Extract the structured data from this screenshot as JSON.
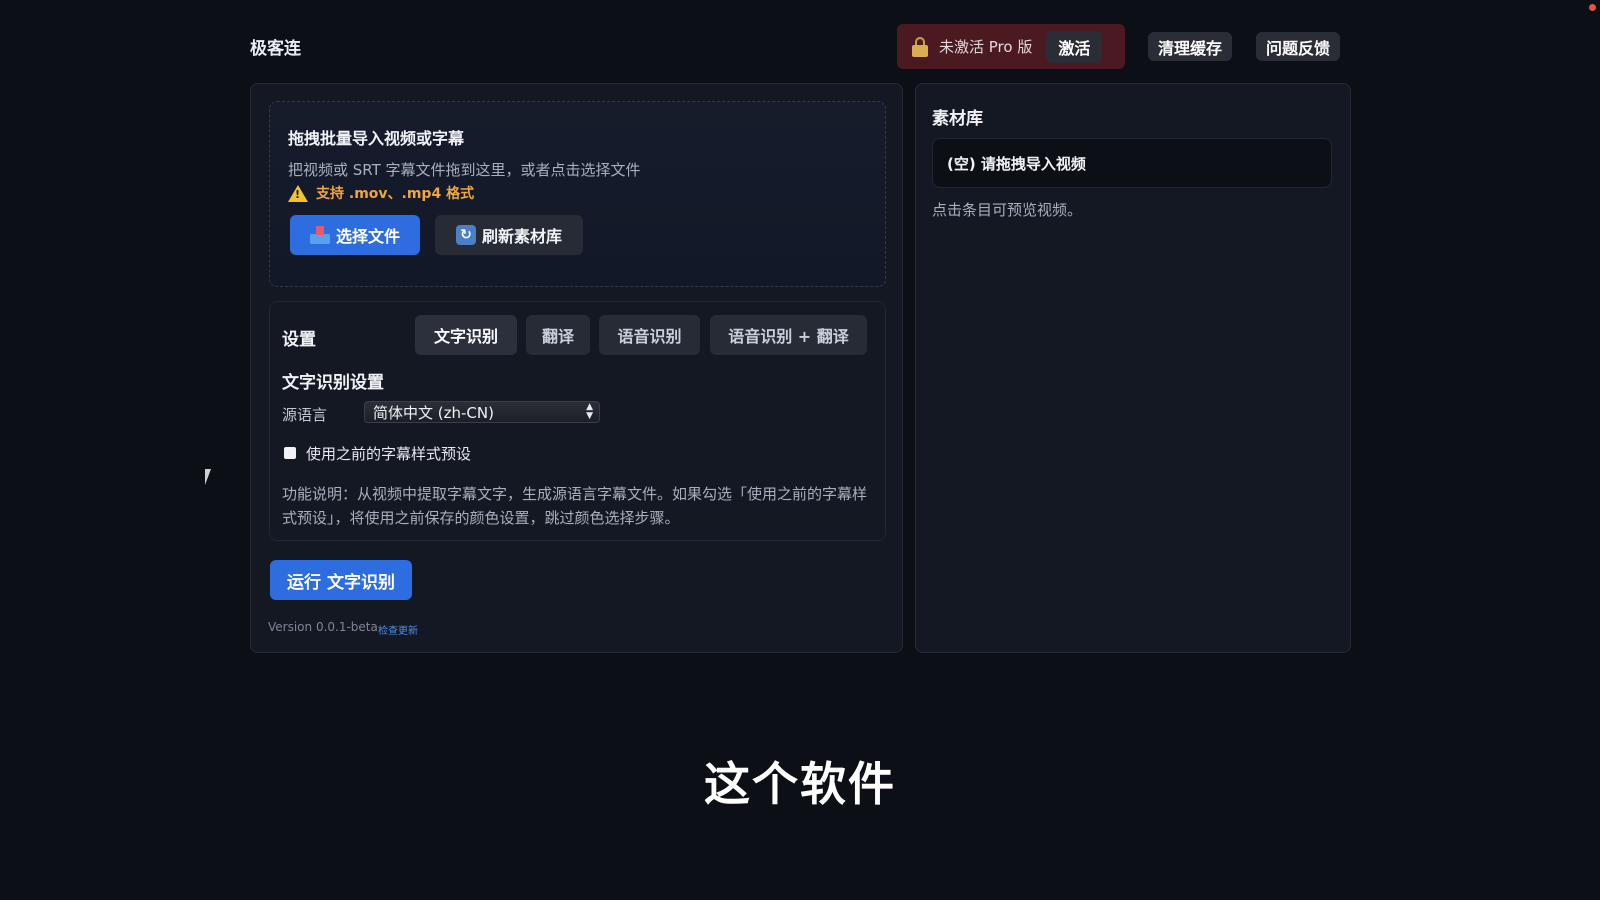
{
  "app": {
    "title": "极客连"
  },
  "header": {
    "pro_status": "未激活 Pro 版",
    "activate_label": "激活",
    "clear_cache_label": "清理缓存",
    "feedback_label": "问题反馈"
  },
  "import": {
    "title": "拖拽批量导入视频或字幕",
    "description": "把视频或 SRT 字幕文件拖到这里，或者点击选择文件",
    "warning": "支持 .mov、.mp4 格式",
    "select_file_label": "选择文件",
    "refresh_label": "刷新素材库"
  },
  "settings": {
    "title": "设置",
    "tabs": [
      {
        "label": "文字识别",
        "active": true
      },
      {
        "label": "翻译",
        "active": false
      },
      {
        "label": "语音识别",
        "active": false
      },
      {
        "label": "语音识别 + 翻译",
        "active": false
      }
    ],
    "section_title": "文字识别设置",
    "source_lang_label": "源语言",
    "source_lang_value": "简体中文 (zh-CN)",
    "checkbox_label": "使用之前的字幕样式预设",
    "checkbox_checked": false,
    "description": "功能说明：从视频中提取字幕文字，生成源语言字幕文件。如果勾选「使用之前的字幕样式预设」，将使用之前保存的颜色设置，跳过颜色选择步骤。"
  },
  "run_label": "运行 文字识别",
  "footer": {
    "version": "Version 0.0.1-beta",
    "check_update": "检查更新"
  },
  "library": {
    "title": "素材库",
    "empty_item": "(空) 请拖拽导入视频",
    "hint": "点击条目可预览视频。"
  },
  "caption": "这个软件",
  "colors": {
    "accent": "#2e6de0",
    "warning": "#f0a63a",
    "pro_bg": "#4a1a20",
    "background": "#0d0f16"
  }
}
